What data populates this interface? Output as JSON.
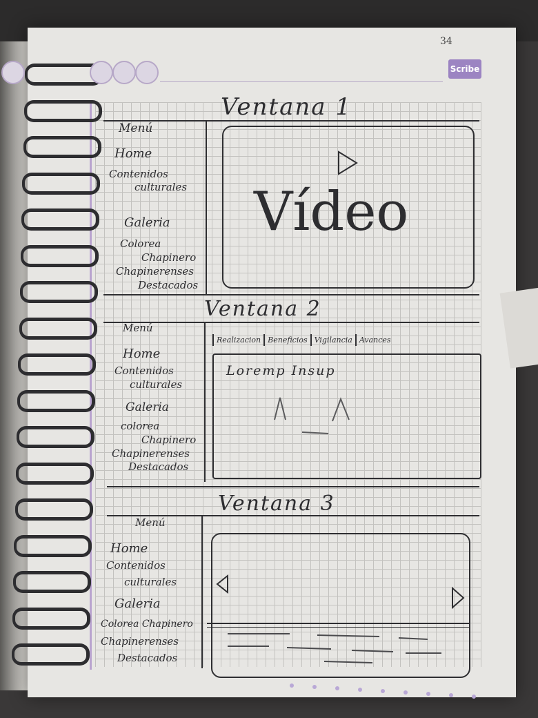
{
  "page_number": "34",
  "brand": "Scribe",
  "windows": [
    {
      "title": "Ventana 1",
      "menu": [
        "Menú",
        "Home",
        "Contenidos",
        "culturales",
        "Galeria",
        "Colorea",
        "Chapinero",
        "Chapinerenses",
        "Destacados"
      ],
      "content_label": "Vídeo"
    },
    {
      "title": "Ventana 2",
      "menu": [
        "Menú",
        "Home",
        "Contenidos",
        "culturales",
        "Galeria",
        "colorea",
        "Chapinero",
        "Chapinerenses",
        "Destacados"
      ],
      "tabs": [
        "Realizacion",
        "Beneficios",
        "Vigilancia",
        "Avances"
      ],
      "content_text": "Loremp Insup"
    },
    {
      "title": "Ventana 3",
      "menu": [
        "Menú",
        "Home",
        "Contenidos",
        "culturales",
        "Galeria",
        "Colorea Chapinero",
        "Chapinerenses",
        "Destacados"
      ]
    }
  ]
}
